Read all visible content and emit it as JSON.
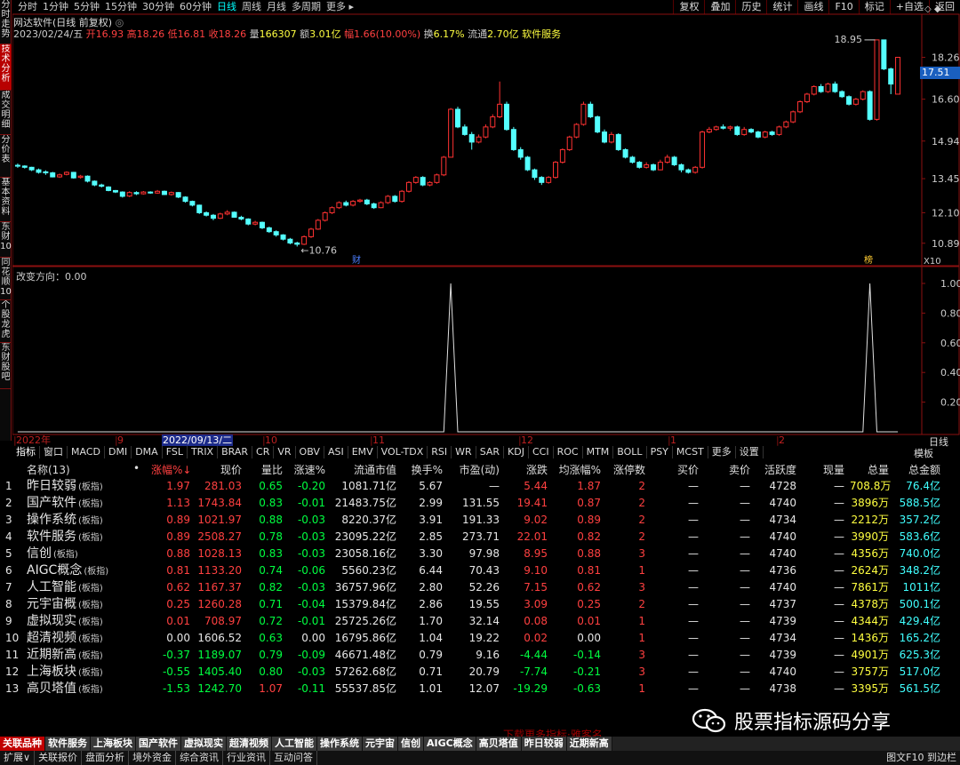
{
  "left_tabs": [
    "分时走势",
    "技术分析",
    "成交明细",
    "分价表",
    "基本资料",
    "东财10",
    "同花顺10",
    "个股龙虎",
    "东财股吧"
  ],
  "periods": [
    "分时",
    "1分钟",
    "5分钟",
    "15分钟",
    "30分钟",
    "60分钟",
    "日线",
    "周线",
    "月线",
    "多周期",
    "更多"
  ],
  "active_period": "日线",
  "right_buttons": [
    "复权",
    "叠加",
    "历史",
    "统计",
    "画线",
    "F10",
    "标记",
    "+自选",
    "返回"
  ],
  "chart_title": "网达软件(日线 前复权)",
  "quote": {
    "date": "2023/02/24/五",
    "open_label": "开",
    "open": "16.93",
    "high_label": "高",
    "high": "18.26",
    "low_label": "低",
    "low": "16.81",
    "close_label": "收",
    "close": "18.26",
    "vol_label": "量",
    "vol": "166307",
    "amt_label": "额",
    "amt": "3.01亿",
    "chg_label": "幅",
    "chg": "1.66(10.00%)",
    "turn_label": "换",
    "turn": "6.17%",
    "float_label": "流通",
    "float": "2.70亿",
    "sector": "软件服务"
  },
  "price_axis": [
    "18.26",
    "16.60",
    "14.94",
    "13.45",
    "12.10",
    "10.89"
  ],
  "current_price": "17.51",
  "high_mark": "18.95",
  "low_mark": "10.76",
  "cai_mark": "财",
  "rong_mark": "榜",
  "x10_label": "X10",
  "indicator_title": "改变方向：0.00",
  "ind_axis": [
    "1.00",
    "0.80",
    "0.60",
    "0.40",
    "0.20"
  ],
  "date_labels": [
    "2022年",
    "9",
    "2022/09/13/二",
    "10",
    "11",
    "12",
    "1",
    "2"
  ],
  "zoom_label": "日线",
  "indicator_tabs": [
    "指标",
    "窗口",
    "MACD",
    "DMI",
    "DMA",
    "FSL",
    "TRIX",
    "BRAR",
    "CR",
    "VR",
    "OBV",
    "ASI",
    "EMV",
    "VOL-TDX",
    "RSI",
    "WR",
    "SAR",
    "KDJ",
    "CCI",
    "ROC",
    "MTM",
    "BOLL",
    "PSY",
    "MCST",
    "更多",
    "设置"
  ],
  "template_btn": "模板",
  "table": {
    "headers": [
      "名称(13)",
      "•",
      "涨幅%↓",
      "现价",
      "量比",
      "涨速%",
      "流通市值",
      "换手%",
      "市盈(动)",
      "涨跌",
      "均涨幅%",
      "涨停数",
      "买价",
      "卖价",
      "活跃度",
      "现量",
      "总量",
      "总金额"
    ],
    "rows": [
      [
        "1",
        "昨日较弱",
        "(板指)",
        "1.97",
        "281.03",
        "0.65",
        "-0.20",
        "1081.71亿",
        "5.67",
        "—",
        "5.44",
        "1.87",
        "2",
        "—",
        "—",
        "4728",
        "—",
        "708.8万",
        "76.4亿"
      ],
      [
        "2",
        "国产软件",
        "(板指)",
        "1.13",
        "1743.84",
        "0.83",
        "-0.01",
        "21483.75亿",
        "2.99",
        "131.55",
        "19.41",
        "0.87",
        "2",
        "—",
        "—",
        "4740",
        "—",
        "3896万",
        "588.5亿"
      ],
      [
        "3",
        "操作系统",
        "(板指)",
        "0.89",
        "1021.97",
        "0.88",
        "-0.03",
        "8220.37亿",
        "3.91",
        "191.33",
        "9.02",
        "0.89",
        "2",
        "—",
        "—",
        "4734",
        "—",
        "2212万",
        "357.2亿"
      ],
      [
        "4",
        "软件服务",
        "(板指)",
        "0.89",
        "2508.27",
        "0.78",
        "-0.03",
        "23095.22亿",
        "2.85",
        "273.71",
        "22.01",
        "0.82",
        "2",
        "—",
        "—",
        "4740",
        "—",
        "3990万",
        "583.6亿"
      ],
      [
        "5",
        "信创",
        "(板指)",
        "0.88",
        "1028.13",
        "0.83",
        "-0.03",
        "23058.16亿",
        "3.30",
        "97.98",
        "8.95",
        "0.88",
        "3",
        "—",
        "—",
        "4740",
        "—",
        "4356万",
        "740.0亿"
      ],
      [
        "6",
        "AIGC概念",
        "(板指)",
        "0.81",
        "1133.20",
        "0.74",
        "-0.06",
        "5560.23亿",
        "6.44",
        "70.43",
        "9.10",
        "0.81",
        "1",
        "—",
        "—",
        "4736",
        "—",
        "2624万",
        "348.2亿"
      ],
      [
        "7",
        "人工智能",
        "(板指)",
        "0.62",
        "1167.37",
        "0.82",
        "-0.03",
        "36757.96亿",
        "2.80",
        "52.26",
        "7.15",
        "0.62",
        "3",
        "—",
        "—",
        "4740",
        "—",
        "7861万",
        "1011亿"
      ],
      [
        "8",
        "元宇宙概",
        "(板指)",
        "0.25",
        "1260.28",
        "0.71",
        "-0.04",
        "15379.84亿",
        "2.86",
        "19.55",
        "3.09",
        "0.25",
        "2",
        "—",
        "—",
        "4737",
        "—",
        "4378万",
        "500.1亿"
      ],
      [
        "9",
        "虚拟现实",
        "(板指)",
        "0.01",
        "708.97",
        "0.72",
        "-0.01",
        "25725.26亿",
        "1.70",
        "32.14",
        "0.08",
        "0.01",
        "1",
        "—",
        "—",
        "4739",
        "—",
        "4344万",
        "429.4亿"
      ],
      [
        "10",
        "超清视频",
        "(板指)",
        "0.00",
        "1606.52",
        "0.63",
        "0.00",
        "16795.86亿",
        "1.04",
        "19.22",
        "0.02",
        "0.00",
        "1",
        "—",
        "—",
        "4734",
        "—",
        "1436万",
        "165.2亿"
      ],
      [
        "11",
        "近期新高",
        "(板指)",
        "-0.37",
        "1189.07",
        "0.79",
        "-0.09",
        "46671.48亿",
        "0.79",
        "9.16",
        "-4.44",
        "-0.14",
        "3",
        "—",
        "—",
        "4739",
        "—",
        "4901万",
        "625.3亿"
      ],
      [
        "12",
        "上海板块",
        "(板指)",
        "-0.55",
        "1405.40",
        "0.80",
        "-0.03",
        "57262.68亿",
        "0.71",
        "20.79",
        "-7.74",
        "-0.21",
        "3",
        "—",
        "—",
        "4740",
        "—",
        "3757万",
        "517.0亿"
      ],
      [
        "13",
        "高贝塔值",
        "(板指)",
        "-1.53",
        "1242.70",
        "1.07",
        "-0.11",
        "55537.85亿",
        "1.01",
        "12.07",
        "-19.29",
        "-0.63",
        "1",
        "—",
        "—",
        "4738",
        "—",
        "3395万",
        "561.5亿"
      ]
    ]
  },
  "bottom_tabs": [
    "关联品种",
    "软件服务",
    "上海板块",
    "国产软件",
    "虚拟现实",
    "超清视频",
    "人工智能",
    "操作系统",
    "元宇宙",
    "信创",
    "AIGC概念",
    "高贝塔值",
    "昨日较弱",
    "近期新高"
  ],
  "status_items": [
    "扩展∨",
    "关联报价",
    "盘面分析",
    "境外资金",
    "综合资讯",
    "行业资讯",
    "互动问答"
  ],
  "status_right": "图文F10 到边栏",
  "watermark": "股票指标源码分享",
  "stamp": "下载更多指标·雅客名",
  "candles": [
    [
      13.98,
      13.95,
      14.05,
      13.88
    ],
    [
      13.95,
      13.9,
      13.98,
      13.85
    ],
    [
      13.9,
      13.8,
      13.92,
      13.75
    ],
    [
      13.8,
      13.7,
      13.85,
      13.65
    ],
    [
      13.72,
      13.68,
      13.78,
      13.6
    ],
    [
      13.68,
      13.52,
      13.72,
      13.5
    ],
    [
      13.52,
      13.6,
      13.65,
      13.48
    ],
    [
      13.62,
      13.7,
      13.74,
      13.58
    ],
    [
      13.7,
      13.48,
      13.72,
      13.45
    ],
    [
      13.5,
      13.55,
      13.6,
      13.45
    ],
    [
      13.55,
      13.35,
      13.58,
      13.3
    ],
    [
      13.35,
      13.2,
      13.38,
      13.15
    ],
    [
      13.2,
      13.15,
      13.25,
      13.1
    ],
    [
      13.12,
      12.98,
      13.15,
      12.95
    ],
    [
      12.98,
      12.92,
      13.0,
      12.88
    ],
    [
      12.92,
      12.75,
      12.95,
      12.7
    ],
    [
      12.76,
      12.9,
      12.95,
      12.72
    ],
    [
      12.9,
      12.85,
      12.95,
      12.8
    ],
    [
      12.85,
      12.92,
      12.96,
      12.82
    ],
    [
      12.92,
      12.88,
      12.95,
      12.85
    ],
    [
      12.88,
      12.95,
      13.0,
      12.85
    ],
    [
      12.95,
      12.82,
      12.98,
      12.8
    ],
    [
      12.82,
      12.9,
      12.94,
      12.78
    ],
    [
      12.9,
      12.72,
      12.92,
      12.68
    ],
    [
      12.72,
      12.55,
      12.75,
      12.5
    ],
    [
      12.55,
      12.4,
      12.58,
      12.35
    ],
    [
      12.4,
      12.1,
      12.42,
      12.05
    ],
    [
      12.1,
      12.0,
      12.15,
      11.95
    ],
    [
      12.0,
      11.88,
      12.05,
      11.8
    ],
    [
      11.88,
      12.05,
      12.1,
      11.85
    ],
    [
      12.05,
      12.12,
      12.2,
      12.0
    ],
    [
      12.12,
      11.92,
      12.15,
      11.9
    ],
    [
      11.92,
      11.85,
      11.98,
      11.8
    ],
    [
      11.85,
      11.65,
      11.88,
      11.6
    ],
    [
      11.65,
      11.72,
      11.78,
      11.6
    ],
    [
      11.72,
      11.5,
      11.75,
      11.45
    ],
    [
      11.5,
      11.35,
      11.55,
      11.3
    ],
    [
      11.35,
      11.22,
      11.4,
      11.15
    ],
    [
      11.22,
      11.05,
      11.25,
      11.0
    ],
    [
      11.05,
      10.9,
      11.1,
      10.85
    ],
    [
      10.9,
      10.85,
      10.95,
      10.76
    ],
    [
      10.85,
      11.15,
      11.2,
      10.82
    ],
    [
      11.15,
      11.45,
      11.5,
      11.1
    ],
    [
      11.45,
      11.8,
      11.85,
      11.42
    ],
    [
      11.8,
      12.1,
      12.15,
      11.75
    ],
    [
      12.1,
      12.3,
      12.35,
      12.05
    ],
    [
      12.3,
      12.5,
      12.55,
      12.25
    ],
    [
      12.5,
      12.4,
      12.58,
      12.35
    ],
    [
      12.4,
      12.55,
      12.6,
      12.35
    ],
    [
      12.55,
      12.6,
      12.65,
      12.5
    ],
    [
      12.6,
      12.45,
      12.65,
      12.4
    ],
    [
      12.45,
      12.3,
      12.5,
      12.25
    ],
    [
      12.3,
      12.5,
      12.55,
      12.28
    ],
    [
      12.5,
      12.75,
      12.8,
      12.45
    ],
    [
      12.75,
      12.55,
      12.8,
      12.5
    ],
    [
      12.55,
      12.95,
      13.0,
      12.5
    ],
    [
      12.95,
      13.3,
      13.35,
      12.9
    ],
    [
      13.3,
      13.5,
      13.55,
      13.25
    ],
    [
      13.5,
      13.2,
      13.55,
      13.15
    ],
    [
      13.2,
      13.3,
      13.35,
      13.15
    ],
    [
      13.3,
      13.6,
      13.65,
      13.25
    ],
    [
      13.6,
      14.3,
      14.35,
      13.55
    ],
    [
      14.3,
      16.2,
      16.25,
      14.28
    ],
    [
      16.2,
      15.5,
      16.3,
      15.45
    ],
    [
      15.5,
      15.2,
      15.6,
      15.15
    ],
    [
      15.2,
      14.9,
      15.3,
      14.6
    ],
    [
      14.9,
      15.1,
      15.2,
      14.85
    ],
    [
      15.1,
      15.5,
      15.6,
      15.05
    ],
    [
      15.5,
      15.9,
      16.0,
      15.45
    ],
    [
      15.9,
      16.4,
      17.3,
      15.85
    ],
    [
      16.4,
      15.4,
      16.5,
      15.35
    ],
    [
      15.4,
      14.6,
      15.5,
      14.55
    ],
    [
      14.6,
      14.3,
      14.7,
      14.2
    ],
    [
      14.3,
      13.8,
      14.35,
      13.75
    ],
    [
      13.8,
      13.5,
      13.85,
      13.4
    ],
    [
      13.5,
      13.3,
      13.55,
      13.2
    ],
    [
      13.3,
      13.5,
      13.55,
      13.25
    ],
    [
      13.5,
      14.1,
      14.15,
      13.45
    ],
    [
      14.1,
      14.6,
      14.65,
      14.05
    ],
    [
      14.6,
      15.1,
      15.15,
      14.55
    ],
    [
      15.1,
      15.6,
      15.65,
      15.05
    ],
    [
      15.6,
      16.4,
      16.5,
      15.55
    ],
    [
      16.4,
      15.9,
      16.5,
      15.85
    ],
    [
      15.9,
      15.3,
      15.95,
      15.25
    ],
    [
      15.3,
      14.9,
      15.4,
      14.85
    ],
    [
      14.9,
      15.2,
      15.3,
      14.85
    ],
    [
      15.2,
      14.6,
      15.25,
      14.55
    ],
    [
      14.6,
      14.3,
      14.65,
      14.25
    ],
    [
      14.3,
      14.1,
      14.35,
      14.05
    ],
    [
      14.1,
      13.9,
      14.15,
      13.85
    ],
    [
      13.9,
      14.0,
      14.1,
      13.85
    ],
    [
      14.0,
      13.8,
      14.05,
      13.75
    ],
    [
      13.8,
      14.1,
      14.2,
      13.78
    ],
    [
      14.1,
      14.3,
      14.4,
      14.05
    ],
    [
      14.3,
      14.0,
      14.35,
      13.95
    ],
    [
      14.0,
      13.8,
      14.05,
      13.7
    ],
    [
      13.8,
      13.7,
      13.85,
      13.65
    ],
    [
      13.7,
      13.9,
      13.95,
      13.65
    ],
    [
      13.9,
      15.3,
      15.35,
      13.85
    ],
    [
      15.3,
      15.4,
      15.5,
      15.25
    ],
    [
      15.4,
      15.5,
      15.55,
      15.35
    ],
    [
      15.5,
      15.45,
      15.6,
      15.4
    ],
    [
      15.45,
      15.5,
      15.55,
      15.35
    ],
    [
      15.5,
      15.2,
      15.55,
      15.15
    ],
    [
      15.2,
      15.4,
      15.5,
      15.15
    ],
    [
      15.4,
      15.3,
      15.45,
      15.25
    ],
    [
      15.3,
      15.1,
      15.35,
      15.05
    ],
    [
      15.1,
      15.3,
      15.35,
      15.05
    ],
    [
      15.3,
      15.2,
      15.35,
      15.15
    ],
    [
      15.2,
      15.5,
      15.55,
      15.15
    ],
    [
      15.5,
      15.7,
      15.75,
      15.45
    ],
    [
      15.7,
      16.1,
      16.15,
      15.65
    ],
    [
      16.1,
      16.5,
      16.55,
      16.05
    ],
    [
      16.5,
      16.8,
      16.85,
      16.45
    ],
    [
      16.8,
      17.1,
      17.15,
      16.75
    ],
    [
      17.1,
      16.9,
      17.2,
      16.85
    ],
    [
      16.9,
      17.2,
      17.25,
      16.85
    ],
    [
      17.2,
      16.9,
      17.3,
      16.85
    ],
    [
      16.9,
      16.7,
      16.95,
      16.65
    ],
    [
      16.7,
      16.4,
      16.75,
      16.35
    ],
    [
      16.4,
      16.6,
      16.65,
      16.35
    ],
    [
      16.6,
      16.9,
      16.95,
      16.55
    ],
    [
      16.9,
      15.8,
      16.95,
      15.75
    ],
    [
      15.8,
      18.95,
      18.95,
      15.75
    ],
    [
      18.95,
      17.8,
      18.95,
      17.75
    ],
    [
      17.8,
      17.2,
      17.85,
      16.8
    ],
    [
      16.8,
      18.26,
      18.26,
      16.81
    ]
  ]
}
